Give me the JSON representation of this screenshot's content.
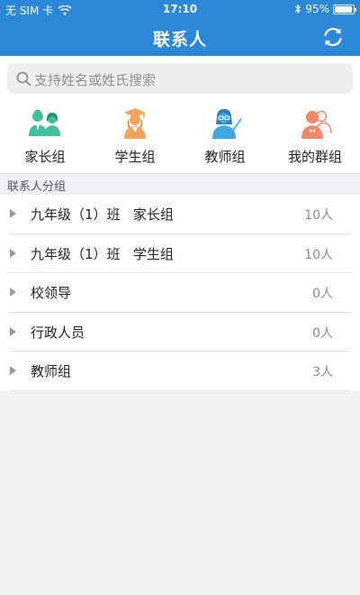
{
  "status_bar": {
    "carrier": "无 SIM 卡",
    "time": "17:10",
    "battery": "95%",
    "battery_level": 0.95
  },
  "navbar": {
    "title": "联系人",
    "refresh_icon": "refresh-icon"
  },
  "search": {
    "placeholder": "支持姓名或姓氏搜索"
  },
  "quick_groups": [
    {
      "label": "家长组",
      "icon": "parents-icon",
      "color": "#3fbf9b"
    },
    {
      "label": "学生组",
      "icon": "graduate-icon",
      "color": "#f2a35a"
    },
    {
      "label": "教师组",
      "icon": "teacher-icon",
      "color": "#3fa7e0"
    },
    {
      "label": "我的群组",
      "icon": "my-group-icon",
      "color": "#f2876b"
    }
  ],
  "section": {
    "title": "联系人分组"
  },
  "contact_groups": [
    {
      "name": "九年级（1）班   家长组",
      "count": "10人"
    },
    {
      "name": "九年级（1）班   学生组",
      "count": "10人"
    },
    {
      "name": "校领导",
      "count": "0人"
    },
    {
      "name": "行政人员",
      "count": "0人"
    },
    {
      "name": "教师组",
      "count": "3人"
    }
  ],
  "colors": {
    "primary": "#2b88d8",
    "background": "#f2f2f2"
  }
}
